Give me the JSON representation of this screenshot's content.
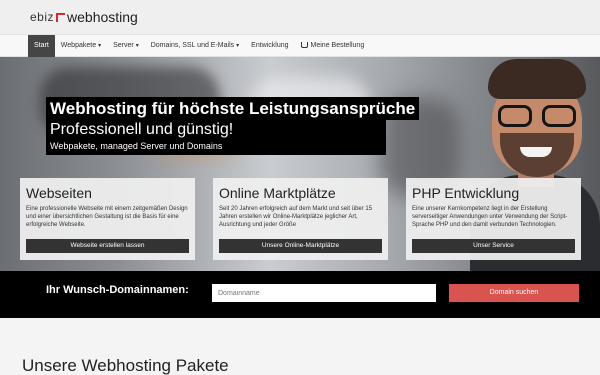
{
  "logo": {
    "part1": "ebiz",
    "part2": "webhosting"
  },
  "nav": {
    "start": "Start",
    "webpakete": "Webpakete",
    "server": "Server",
    "domains": "Domains, SSL und E-Mails",
    "entwicklung": "Entwicklung",
    "bestellung": "Meine Bestellung",
    "caret": "▾"
  },
  "hero": {
    "title": "Webhosting für höchste Leistungsansprüche",
    "subtitle": "Professionell und günstig!",
    "tagline": "Webpakete, managed Server und Domains"
  },
  "cards": [
    {
      "title": "Webseiten",
      "text": "Eine professionelle Webseite mit einem zeitgemäßen Design und einer übersichtlichen Gestaltung ist die Basis für eine erfolgreiche Webseite.",
      "button": "Webseite erstellen lassen"
    },
    {
      "title": "Online Marktplätze",
      "text": "Seit 20 Jahren erfolgreich auf dem Markt und seit über 15 Jahren erstellen wir Online-Marktplätze jeglicher Art, Ausrichtung und jeder Größe",
      "button": "Unsere Online-Marktplätze"
    },
    {
      "title": "PHP Entwicklung",
      "text": "Eine unserer Kernkompetenz liegt in der Erstellung serverseitiger Anwendungen unter Verwendung der Script-Sprache PHP und den damit verbunden Technologien.",
      "button": "Unser Service"
    }
  ],
  "domain": {
    "label": "Ihr Wunsch-Domainnamen:",
    "placeholder": "Domainname",
    "button": "Domain suchen"
  },
  "section": {
    "title": "Unsere Webhosting Pakete"
  },
  "colors": {
    "accent": "#d9534f",
    "dark": "#333333",
    "logo_red": "#d32b2b"
  }
}
